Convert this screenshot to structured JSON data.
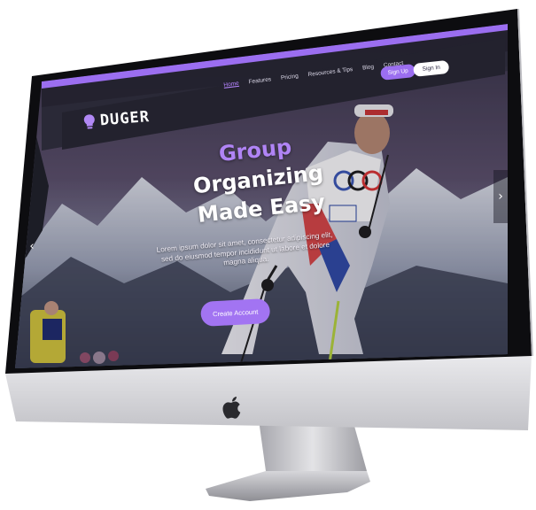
{
  "colors": {
    "accent": "#9b6ef0",
    "nav_bg": "#2b2b36",
    "screen_bg": "#3b3a4e",
    "monitor_silver": "#d9d9dc",
    "bezel": "#0d0d10"
  },
  "navbar": {
    "logo_text": "DUGER",
    "logo_icon": "lightbulb-icon",
    "links": [
      {
        "label": "Home",
        "active": true
      },
      {
        "label": "Features",
        "active": false
      },
      {
        "label": "Pricing",
        "active": false
      },
      {
        "label": "Resources & Tips",
        "active": false
      },
      {
        "label": "Blog",
        "active": false
      },
      {
        "label": "Contact",
        "active": false
      }
    ],
    "signup_label": "Sign Up",
    "signin_label": "Sign In"
  },
  "hero": {
    "title_accent": "Group",
    "title_line1_rest": " Organizing",
    "title_line2": "Made Easy",
    "body": "Lorem ipsum dolor sit amet, consectetur adipiscing elit, sed do eiusmod tempor incididunt ut labore et dolore magna aliqua.",
    "cta_label": "Create Account",
    "prev_icon": "chevron-left-icon",
    "next_icon": "chevron-right-icon",
    "prev_glyph": "‹",
    "next_glyph": "›"
  },
  "device": {
    "chin_logo": "apple-logo-icon"
  }
}
